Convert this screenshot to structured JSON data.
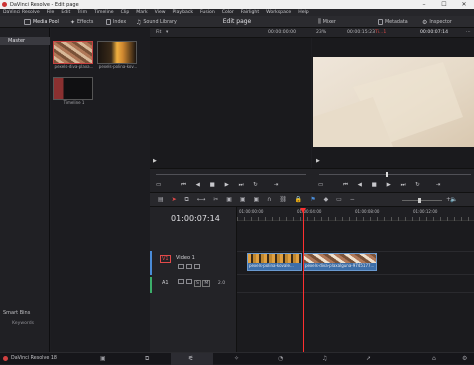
{
  "window": {
    "title": "DaVinci Resolve - Edit page",
    "controls": [
      "–",
      "☐",
      "✕"
    ]
  },
  "menu": [
    "DaVinci Resolve",
    "File",
    "Edit",
    "Trim",
    "Timeline",
    "Clip",
    "Mark",
    "View",
    "Playback",
    "Fusion",
    "Color",
    "Fairlight",
    "Workspace",
    "Help"
  ],
  "toolbar": {
    "media_pool": "Media Pool",
    "effects": "Effects",
    "index": "Index",
    "sound_library": "Sound Library",
    "page_title": "Edit page",
    "mixer": "Mixer",
    "metadata": "Metadata",
    "inspector": "Inspector"
  },
  "viewer": {
    "fit": "Fit",
    "source_timecode": "00:00:00:00",
    "zoom": "23%",
    "duration": "00:00:15:23",
    "timeline_name": "Ti...1",
    "record_timecode": "00:00:07:14"
  },
  "sidebar": {
    "master": "Master",
    "smart_bins": "Smart Bins",
    "keywords": "Keywords"
  },
  "pool": {
    "clips": [
      {
        "label": "pexels-diva-plaxa..."
      },
      {
        "label": "pexels-polina-kov..."
      },
      {
        "label": "Timeline 1"
      }
    ]
  },
  "timeline": {
    "timecode": "01:00:07:14",
    "ruler": [
      "01:00:00:00",
      "01:00:04:00",
      "01:00:08:00",
      "01:00:12:00"
    ],
    "tracks": {
      "video": {
        "id": "V1",
        "name": "Video 1"
      },
      "audio": {
        "id": "A1",
        "value": "2.0"
      }
    },
    "clips": [
      {
        "label": "pexels-polina-kovale..."
      },
      {
        "label": "pexels-diva-plaxalguna-9745177..."
      }
    ]
  },
  "statusbar": {
    "app": "DaVinci Resolve 18"
  },
  "colors": {
    "accent": "#e24a4a",
    "clip_blue": "#3d6ea8",
    "playhead": "#ff3030",
    "timecode": "#e0e0e4"
  }
}
